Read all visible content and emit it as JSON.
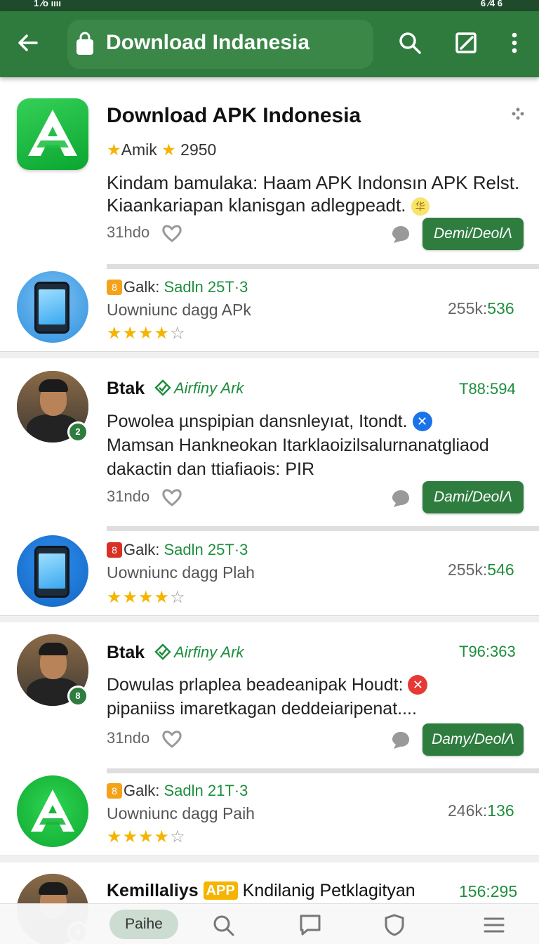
{
  "status_bar": {
    "left": "1 ⁄o ıııı",
    "right": "6 ⁄4 6"
  },
  "app_bar": {
    "title": "Download Indanesia"
  },
  "featured": {
    "title": "Download APK Indonesia",
    "rating_label": "Amik",
    "rating_count": "2950",
    "description": "Kindam bamulaka: Haam APK Indonsın APK Relst. Kiaankariapan klanisgan adlegpeadt.",
    "badge": "华",
    "time": "31hdo",
    "button": "Demi/DeolΛ"
  },
  "app_rows": [
    {
      "tag": "8",
      "tag_color": "#f4a21a",
      "title_prefix": "Galk:",
      "title_green": "Sadln 25T·3",
      "subtitle": "Uowniunc dagg APk",
      "stars": 4,
      "count_prefix": "255k:",
      "count_green": "536"
    },
    {
      "tag": "8",
      "tag_color": "#d93025",
      "title_prefix": "Galk:",
      "title_green": "Sadln 25T·3",
      "subtitle": "Uowniunc dagg Plah",
      "stars": 4,
      "count_prefix": "255k:",
      "count_green": "546"
    },
    {
      "tag": "8",
      "tag_color": "#f4a21a",
      "title_prefix": "Galk:",
      "title_green": "Sadln 21T·3",
      "subtitle": "Uowniunc dagg Paih",
      "stars": 4,
      "count_prefix": "246k:",
      "count_green": "136"
    }
  ],
  "posts": [
    {
      "name": "Btak",
      "verified": "Airfiny Ark",
      "time": "T88:594",
      "line1": "Powolea µnspipian dansnleyıat, Itondt.",
      "mark": "✕",
      "mark_color": "#1a73e8",
      "line2": "Mamsan Hankneokan Itarklaoizilsalurnanatgliaod dakactin dan ttiafiaois: PIR",
      "meta": "31ndo",
      "button": "Dami/DeolΛ",
      "avbadge": "2"
    },
    {
      "name": "Btak",
      "verified": "Airfiny Ark",
      "time": "T96:363",
      "line1": "Dowulas prlaplea beadeanipak Houdt:",
      "mark": "✕",
      "mark_color": "#e53935",
      "line2": "pipaniiss imaretkagan deddeiaripenat....",
      "meta": "31ndo",
      "button": "Damy/DeolΛ",
      "avbadge": "8"
    }
  ],
  "bottom_post": {
    "name": "Kemillaliys",
    "app_tag": "APP",
    "rest": "Kndilanig Petklagityan",
    "time": "156:295"
  },
  "bottom_nav": {
    "active_label": "Paihe"
  },
  "colors": {
    "primary": "#2f7b3e",
    "accent": "#1e8e3e",
    "star": "#f4b400"
  }
}
